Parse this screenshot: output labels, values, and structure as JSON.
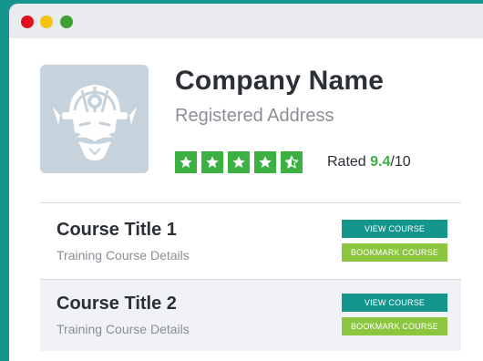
{
  "window": {
    "controls": [
      "close",
      "minimize",
      "maximize"
    ],
    "colors": {
      "close": "#e0101d",
      "minimize": "#f4c20b",
      "maximize": "#3ea136"
    }
  },
  "company": {
    "name": "Company Name",
    "address": "Registered Address",
    "logo_icon": "bearded-guardian-mascot-icon"
  },
  "rating": {
    "stars_full": 4,
    "stars_half": 1,
    "stars_total": 5,
    "prefix": "Rated ",
    "score": "9.4",
    "suffix": "/10",
    "star_color": "#3db043"
  },
  "courses": [
    {
      "title": "Course Title 1",
      "details": "Training Course Details",
      "view_label": "VIEW COURSE",
      "bookmark_label": "BOOKMARK COURSE"
    },
    {
      "title": "Course Title 2",
      "details": "Training Course Details",
      "view_label": "VIEW COURSE",
      "bookmark_label": "BOOKMARK COURSE"
    }
  ],
  "colors": {
    "accent": "#14968d",
    "bookmark": "#8cc63f",
    "background": "#14968d"
  }
}
